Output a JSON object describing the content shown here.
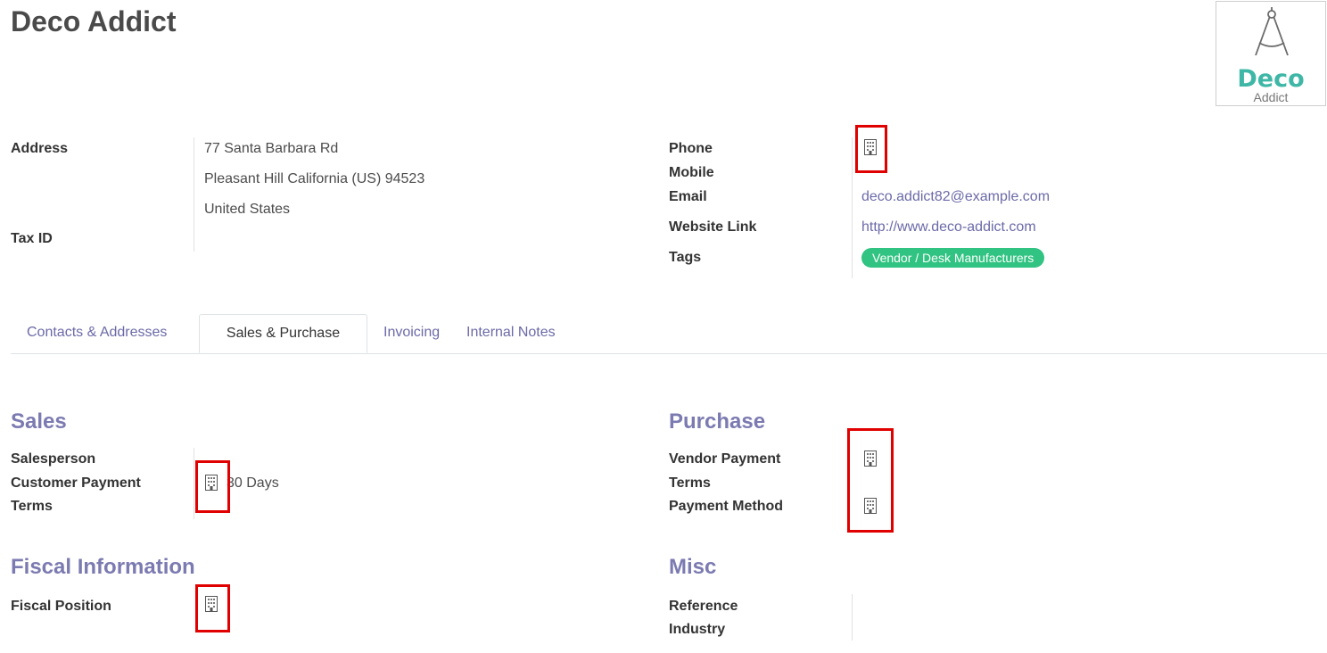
{
  "partner": {
    "name": "Deco Addict",
    "logo": {
      "brand": "Deco",
      "sub": "Addict"
    }
  },
  "left_info": {
    "address_label": "Address",
    "address_lines": [
      "77 Santa Barbara Rd",
      "Pleasant Hill  California (US)  94523",
      "United States"
    ],
    "tax_id_label": "Tax ID"
  },
  "right_info": {
    "phone_label": "Phone",
    "mobile_label": "Mobile",
    "email_label": "Email",
    "email_value": "deco.addict82@example.com",
    "website_label": "Website Link",
    "website_value": "http://www.deco-addict.com",
    "tags_label": "Tags",
    "tags": [
      "Vendor / Desk Manufacturers"
    ]
  },
  "tabs": [
    {
      "label": "Contacts & Addresses",
      "active": false
    },
    {
      "label": "Sales & Purchase",
      "active": true
    },
    {
      "label": "Invoicing",
      "active": false
    },
    {
      "label": "Internal Notes",
      "active": false
    }
  ],
  "sales": {
    "title": "Sales",
    "salesperson_label": "Salesperson",
    "payment_terms_label_1": "Customer Payment",
    "payment_terms_label_2": "Terms",
    "payment_terms_value": "30 Days"
  },
  "purchase": {
    "title": "Purchase",
    "vendor_terms_label_1": "Vendor Payment",
    "vendor_terms_label_2": "Terms",
    "payment_method_label": "Payment Method"
  },
  "fiscal": {
    "title": "Fiscal Information",
    "fiscal_position_label": "Fiscal Position"
  },
  "misc": {
    "title": "Misc",
    "reference_label": "Reference",
    "industry_label": "Industry"
  },
  "colors": {
    "link": "#6b6aa8",
    "section_title": "#7b7ab1",
    "tag_bg": "#30c381",
    "highlight": "#e00000",
    "logo_brand": "#3fb7a6"
  },
  "icons": {
    "company_field_icon": "building-icon"
  }
}
